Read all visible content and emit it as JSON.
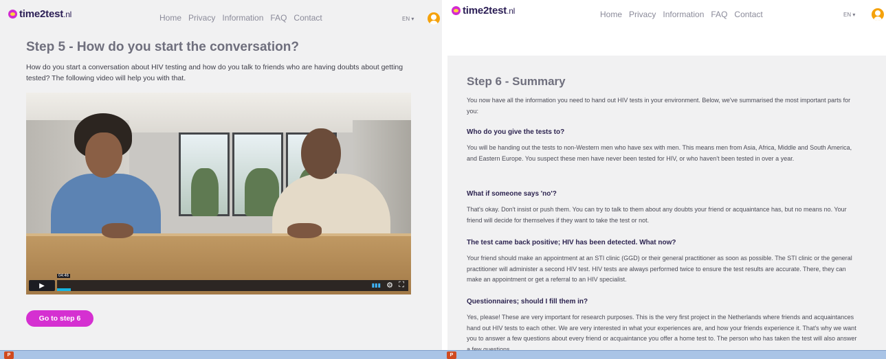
{
  "left": {
    "logo": {
      "name": "time2test",
      "tld": ".nl"
    },
    "nav": [
      "Home",
      "Privacy",
      "Information",
      "FAQ",
      "Contact"
    ],
    "language": "EN ▾",
    "title": "Step 5 - How do you start the conversation?",
    "intro": "How do you start a conversation about HIV testing and how do you talk to friends who are having doubts about getting tested? The following video will help you with that.",
    "video": {
      "duration": "04:46",
      "played_fraction": 0.04
    },
    "next_button": "Go to step 6"
  },
  "right": {
    "logo": {
      "name": "time2test",
      "tld": ".nl"
    },
    "nav": [
      "Home",
      "Privacy",
      "Information",
      "FAQ",
      "Contact"
    ],
    "language": "EN ▾",
    "title": "Step 6 - Summary",
    "intro": "You now have all the information you need to hand out HIV tests in your environment. Below, we've summarised the most important parts for you:",
    "sections": [
      {
        "heading": "Who do you give the tests to?",
        "text": "You will be handing out the tests to non-Western men who have sex with men. This means men from Asia, Africa, Middle and South America, and Eastern Europe. You suspect these men have never been tested for HIV, or who haven't been tested in over a year."
      },
      {
        "heading": "What if someone says 'no'?",
        "text": "That's okay. Don't insist or push them. You can try to talk to them about any doubts your friend or acquaintance has, but no means no. Your friend will decide for themselves if they want to take the test or not."
      },
      {
        "heading": "The test came back positive; HIV has been detected. What now?",
        "text": "Your friend should make an appointment at an STI clinic (GGD) or their general practitioner as soon as possible. The STI clinic or the general practitioner will administer a second HIV test. HIV tests are always performed twice to ensure the test results are accurate. There, they can make an appointment or get a referral to an HIV specialist."
      },
      {
        "heading": "Questionnaires; should I fill them in?",
        "text": "Yes, please! These are very important for research purposes. This is the very first project in the Netherlands where friends and acquaintances hand out HIV tests to each other. We are very interested in what your experiences are, and how your friends experience it. That's why we want you to answer a few questions about every friend or acquaintance you offer a home test to. The person who has taken the test will also answer a few questions."
      }
    ]
  },
  "taskbar": {
    "icon_label": "P"
  },
  "colors": {
    "accent": "#d530d1",
    "brand_dark": "#2b1e55",
    "user_icon": "#f5a20c"
  }
}
